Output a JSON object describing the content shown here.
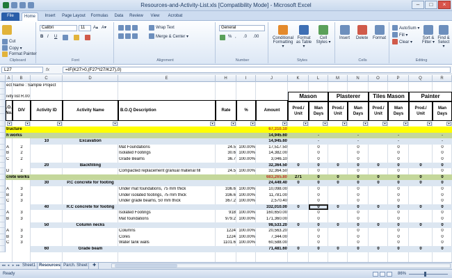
{
  "window": {
    "title": "Resources-and-Activity-List.xls  [Compatibility Mode]  -  Microsoft Excel"
  },
  "tabs": [
    {
      "label": "File",
      "x": 0,
      "w": 0
    },
    {
      "label": "Home"
    },
    {
      "label": "Insert"
    },
    {
      "label": "Page Layout"
    },
    {
      "label": "Formulas"
    },
    {
      "label": "Data"
    },
    {
      "label": "Review"
    },
    {
      "label": "View"
    },
    {
      "label": "Acrobat"
    }
  ],
  "ribbon": {
    "clipboard": {
      "cut": "Cut",
      "copy": "Copy ▾",
      "painter": "Format Painter",
      "label": "Clipboard"
    },
    "font": {
      "name": "Calibri",
      "size": "11",
      "label": "Font"
    },
    "alignment": {
      "wrap": "Wrap Text",
      "merge": "Merge & Center ▾",
      "label": "Alignment"
    },
    "number": {
      "format": "General",
      "label": "Number"
    },
    "styles": {
      "cond": "Conditional Formatting ▾",
      "table": "Format as Table ▾",
      "cell": "Cell Styles ▾",
      "label": "Styles"
    },
    "cells": {
      "insert": "Insert",
      "delete": "Delete",
      "format": "Format",
      "label": "Cells"
    },
    "editing": {
      "autosum": "AutoSum ▾",
      "fill": "Fill ▾",
      "clear": "Clear ▾",
      "sort": "Sort & Filter ▾",
      "find": "Find & Select ▾",
      "label": "Editing"
    }
  },
  "formula_bar": {
    "cell": "L27",
    "fx": "fx",
    "formula": "=IF(K27>0,(F27*I27/K27),0)"
  },
  "columns": [
    "A",
    "B",
    "C",
    "D",
    "E",
    "H",
    "I",
    "J",
    "K",
    "L",
    "M",
    "N",
    "O",
    "P",
    "Q",
    "R"
  ],
  "sheet": {
    "project": "ect Name : Sample Project",
    "list": "ivity list R.00",
    "headers": {
      "boq": "B.O.Q\nNo.",
      "div": "DIV",
      "activity_id": "Activity ID",
      "activity_name": "Activity Name",
      "boq_desc": "B.O.Q Description",
      "rate": "Rate",
      "pct": "%",
      "amount": "Amount",
      "mason": "Mason",
      "plasterer": "Plasterer",
      "tiles_mason": "Tiles Mason",
      "painter": "Painter",
      "prod": "Prod./\nUnit",
      "man": "Man\nDays"
    },
    "rows": [
      {
        "a": "",
        "b": "",
        "c": "",
        "d": "",
        "e": "",
        "h": "",
        "i": "",
        "j": "",
        "k": "",
        "l": "",
        "m": "",
        "n": "",
        "o": "",
        "p": "",
        "q": "",
        "r": "",
        "kind": "spacer"
      },
      {
        "a": "",
        "b": "",
        "c": "",
        "d": "",
        "e": "",
        "h": "",
        "i": "",
        "j": "",
        "k": "",
        "l": "",
        "m": "",
        "n": "",
        "o": "",
        "p": "",
        "q": "",
        "r": "",
        "kind": "filter"
      }
    ],
    "data": [
      {
        "a": "tructure",
        "j": "67,310.10",
        "kind": "yellow"
      },
      {
        "a": "h works",
        "j": "14,945.60",
        "dash": true,
        "kind": "green"
      },
      {
        "c": "10",
        "d": "Excavation",
        "j": "14,945.60",
        "dash": true,
        "kind": "act"
      },
      {
        "a": "A",
        "b": "2",
        "e": "Mat Foundations",
        "h": "24.5",
        "i": "100.00%",
        "j": "17,517.50",
        "z": true
      },
      {
        "a": "B",
        "b": "2",
        "e": "Isolated Footings",
        "h": "30.6",
        "i": "100.00%",
        "j": "14,382.00",
        "z": true
      },
      {
        "a": "C",
        "b": "2",
        "e": "Grade Beams",
        "h": "36.7",
        "i": "100.00%",
        "j": "3,046.10",
        "z": true
      },
      {
        "c": "20",
        "d": "Backfilling",
        "j": "32,364.50",
        "zb": true,
        "kind": "act"
      },
      {
        "a": "D",
        "b": "2",
        "e": "Compacted replacement granual material fill",
        "h": "24.5",
        "i": "100.00%",
        "j": "32,364.50",
        "z": true
      },
      {
        "a": "crete works",
        "j": "683,265.80",
        "k": "271",
        "zb": true,
        "kind": "green"
      },
      {
        "c": "30",
        "d": "P.C concrete for footing",
        "j": "24,449.40",
        "zb": true,
        "kind": "act"
      },
      {
        "a": "A",
        "b": "3",
        "e": "Under mat foundations, 75 mm thick",
        "h": "336.6",
        "i": "100.00%",
        "j": "10,098.00",
        "z": true
      },
      {
        "a": "B",
        "b": "3",
        "e": "Under isolated footings, 75 mm thick",
        "h": "336.6",
        "i": "100.00%",
        "j": "11,781.00",
        "z": true
      },
      {
        "a": "C",
        "b": "3",
        "e": "Under grade beams, 50 mm thick",
        "h": "367.2",
        "i": "100.00%",
        "j": "2,570.40",
        "z": true
      },
      {
        "c": "40",
        "d": "R.C concrete for footing",
        "j": "332,010.00",
        "zb": true,
        "kind": "act"
      },
      {
        "a": "A",
        "b": "3",
        "e": "Isolated Footings",
        "h": "918",
        "i": "100.00%",
        "j": "160,650.00",
        "z": true
      },
      {
        "a": "B",
        "b": "3",
        "e": "Mat foundations",
        "h": "979.2",
        "i": "100.00%",
        "j": "171,360.00",
        "z": true
      },
      {
        "c": "50",
        "d": "Column necks",
        "j": "98,533.20",
        "zb": true,
        "kind": "act"
      },
      {
        "a": "A",
        "b": "3",
        "e": "Columns",
        "h": "1224",
        "i": "100.00%",
        "j": "20,563.20",
        "z": true
      },
      {
        "a": "B",
        "b": "3",
        "e": "Cores",
        "h": "1224",
        "i": "100.00%",
        "j": "7,344.00",
        "z": true
      },
      {
        "a": "C",
        "b": "3",
        "e": "Water tank walls",
        "h": "1101.6",
        "i": "100.00%",
        "j": "60,588.00",
        "z": true
      },
      {
        "c": "60",
        "d": "Grade beam",
        "j": "71,481.60",
        "zb": true,
        "kind": "act"
      }
    ]
  },
  "sheet_tabs": [
    {
      "label": "Sheet1"
    },
    {
      "label": "Resources"
    },
    {
      "label": "Parch. Sheet"
    }
  ],
  "status": {
    "ready": "Ready",
    "zoom": "86%"
  }
}
